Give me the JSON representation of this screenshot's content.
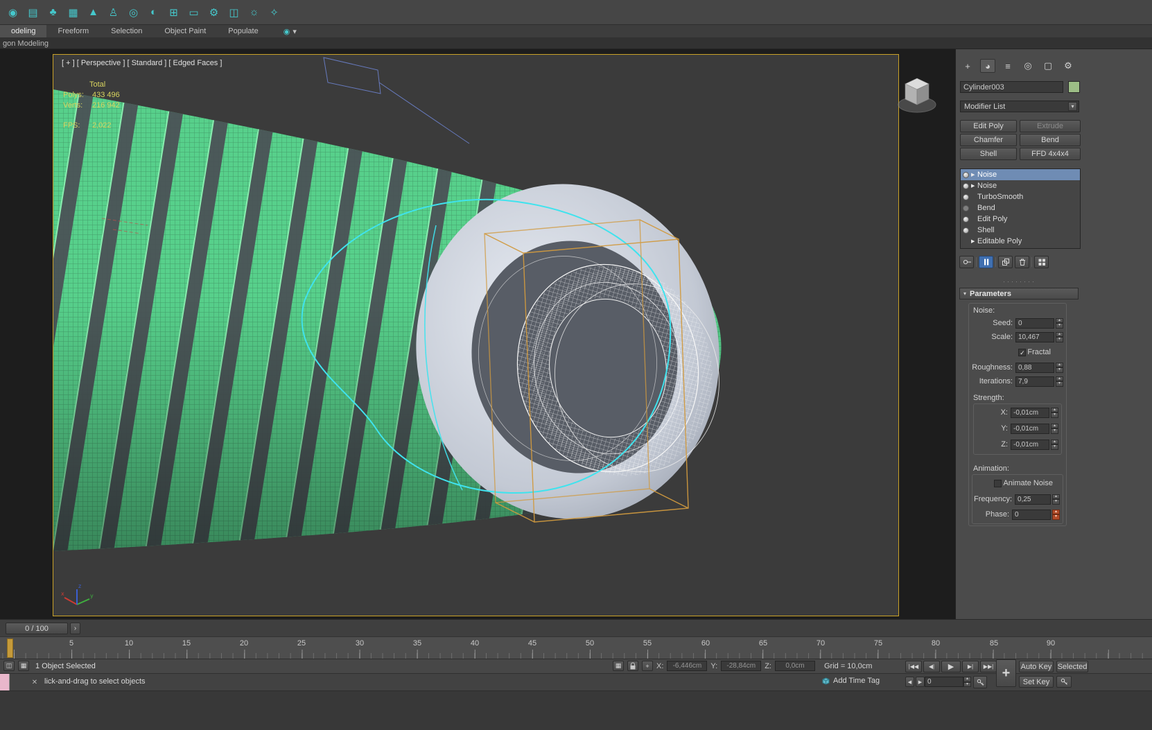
{
  "toolbar": {
    "icons": [
      {
        "name": "teapot",
        "glyph": "◉"
      },
      {
        "name": "camera",
        "glyph": "▤"
      },
      {
        "name": "trees",
        "glyph": "♣"
      },
      {
        "name": "checker-board",
        "glyph": "▦"
      },
      {
        "name": "terrain",
        "glyph": "▲"
      },
      {
        "name": "character",
        "glyph": "♙"
      },
      {
        "name": "torus",
        "glyph": "◎"
      },
      {
        "name": "pipe",
        "glyph": "◐"
      },
      {
        "name": "add-object",
        "glyph": "⊞"
      },
      {
        "name": "display",
        "glyph": "▭"
      },
      {
        "name": "gears",
        "glyph": "⚙"
      },
      {
        "name": "window",
        "glyph": "◫"
      },
      {
        "name": "scope",
        "glyph": "☼"
      },
      {
        "name": "lightbulb",
        "glyph": "✧"
      }
    ]
  },
  "ribbon": {
    "tabs": [
      {
        "label": "odeling",
        "active": true
      },
      {
        "label": "Freeform"
      },
      {
        "label": "Selection"
      },
      {
        "label": "Object Paint"
      },
      {
        "label": "Populate"
      }
    ],
    "overflow_icon_glyph": "◉",
    "overflow_glyph": "▾",
    "panel_label": "gon Modeling"
  },
  "viewport": {
    "label": "[ + ] [ Perspective ] [ Standard ] [ Edged Faces ]",
    "stats": {
      "total_label": "Total",
      "polys_label": "Polys:",
      "polys_value": "433 496",
      "verts_label": "Verts:",
      "verts_value": "216 942",
      "fps_label": "FPS:",
      "fps_value": "2,022"
    }
  },
  "command_panel": {
    "tabs": [
      {
        "name": "create",
        "glyph": "+"
      },
      {
        "name": "modify",
        "glyph": "◕",
        "active": true
      },
      {
        "name": "hierarchy",
        "glyph": "≡"
      },
      {
        "name": "motion",
        "glyph": "◎"
      },
      {
        "name": "display",
        "glyph": "▢"
      },
      {
        "name": "utilities",
        "glyph": "⚙"
      }
    ],
    "object_name": "Cylinder003",
    "modifier_list_label": "Modifier List",
    "dropdown_glyph": "▾",
    "mod_buttons": [
      {
        "label": "Edit Poly"
      },
      {
        "label": "Extrude",
        "disabled": true
      },
      {
        "label": "Chamfer"
      },
      {
        "label": "Bend"
      },
      {
        "label": "Shell"
      },
      {
        "label": "FFD 4x4x4"
      }
    ],
    "stack": [
      {
        "name": "Noise",
        "bulb": true,
        "arrow": true,
        "selected": true
      },
      {
        "name": "Noise",
        "bulb": true,
        "arrow": true
      },
      {
        "name": "TurboSmooth",
        "bulb": true
      },
      {
        "name": "Bend",
        "bulb": true,
        "dim": true
      },
      {
        "name": "Edit Poly",
        "bulb": true
      },
      {
        "name": "Shell",
        "bulb": true
      },
      {
        "name": "Editable Poly",
        "arrow": true
      }
    ],
    "resize_dots": "········",
    "rollout": {
      "title": "Parameters",
      "collapse_glyph": "▾"
    },
    "parameters": {
      "noise_label": "Noise:",
      "seed_label": "Seed:",
      "seed_value": "0",
      "scale_label": "Scale:",
      "scale_value": "10,467",
      "fractal_label": "Fractal",
      "check_glyph": "✓",
      "roughness_label": "Roughness:",
      "roughness_value": "0,88",
      "iterations_label": "Iterations:",
      "iterations_value": "7,9",
      "strength_label": "Strength:",
      "x_label": "X:",
      "x_value": "-0,01cm",
      "y_label": "Y:",
      "y_value": "-0,01cm",
      "z_label": "Z:",
      "z_value": "-0,01cm",
      "animation_label": "Animation:",
      "animate_noise_label": "Animate Noise",
      "frequency_label": "Frequency:",
      "frequency_value": "0,25",
      "phase_label": "Phase:",
      "phase_value": "0"
    }
  },
  "timeline": {
    "frame_display": "0 / 100",
    "next_glyph": "›",
    "ticks": [
      "5",
      "10",
      "15",
      "20",
      "25",
      "30",
      "35",
      "40",
      "45",
      "50",
      "55",
      "60",
      "65",
      "70",
      "75",
      "80",
      "85",
      "90"
    ]
  },
  "status_bar": {
    "selection_text": "1 Object Selected",
    "x_label": "X:",
    "x_value": "-6,446cm",
    "y_label": "Y:",
    "y_value": "-28,84cm",
    "z_label": "Z:",
    "z_value": "0,0cm",
    "grid_text": "Grid = 10,0cm",
    "playback": {
      "go_start": "|◀◀",
      "prev_frame": "◀|",
      "play": "▶",
      "next_frame": "▶|",
      "go_end": "▶▶|",
      "mini_prev": "◀",
      "mini_next": "▶"
    },
    "auto_key_label": "Auto Key",
    "selected_label": "Selected",
    "set_key_label": "Set Key",
    "time_field_value": "0",
    "add_time_tag_label": "Add Time Tag",
    "prompt": "lick-and-drag to select objects",
    "clear_glyph": "✕",
    "large_plus_glyph": "+"
  },
  "colors": {
    "viewport_border": "#c9a227",
    "wireframe_green": "#57d08b",
    "cyan_outline": "#3fe3ee",
    "ffd_orange": "#d19a3f",
    "selected_modifier_bg": "#6f8cb4",
    "object_color_swatch": "#9cbd86",
    "toolbar_icon_teal": "#45c8cc",
    "phase_spinner_hot": "#b04a28"
  }
}
